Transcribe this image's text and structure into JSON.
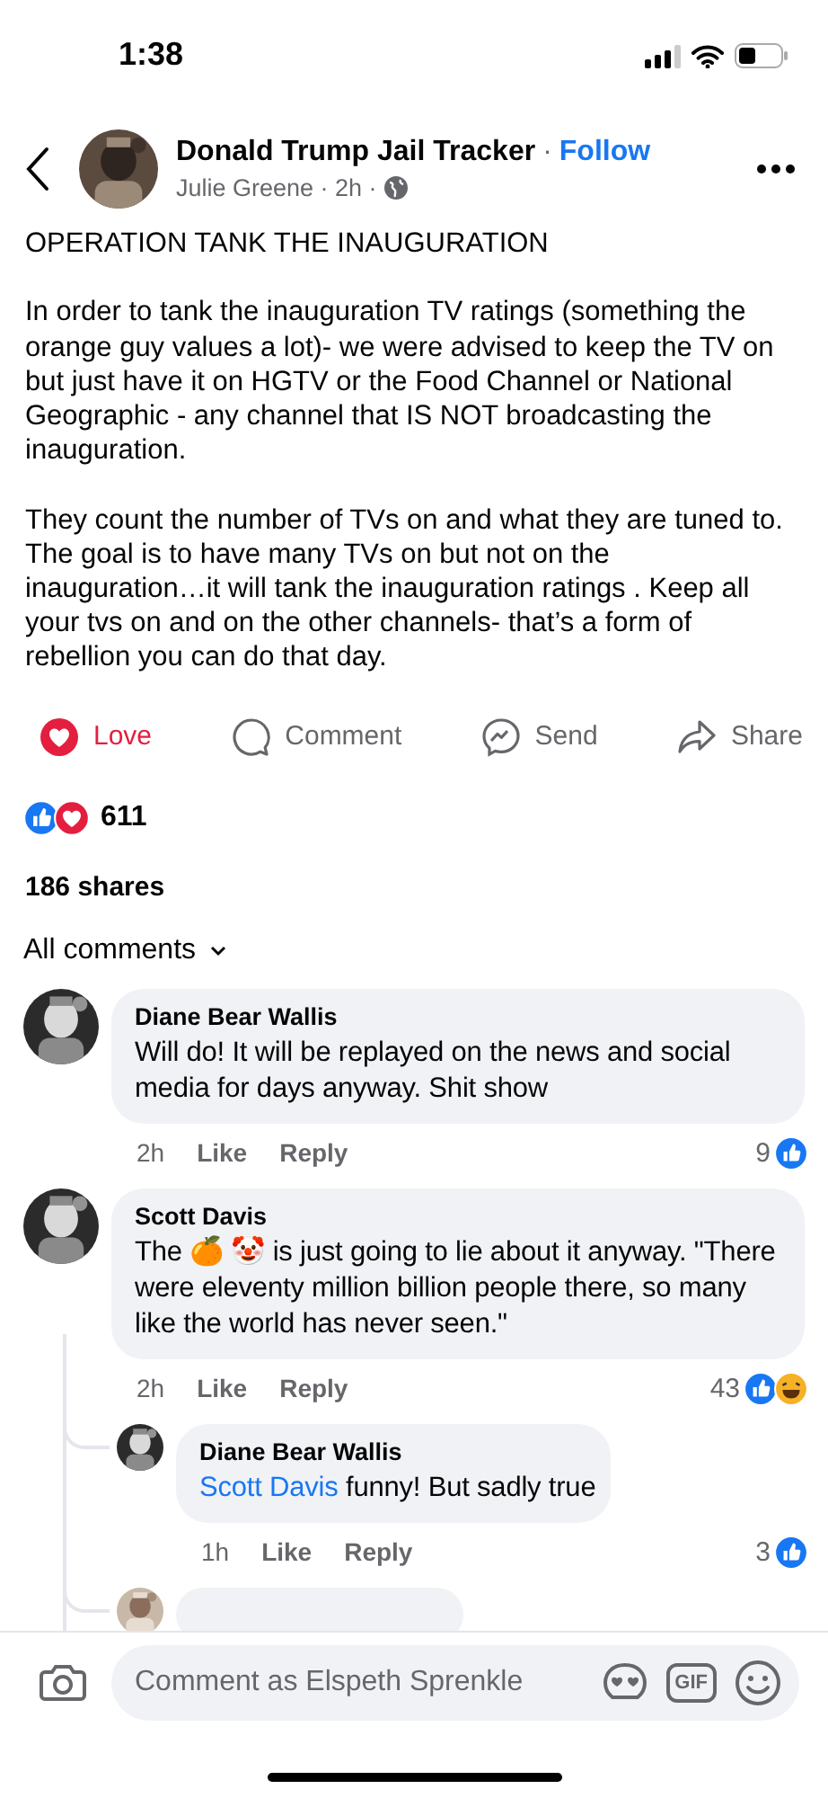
{
  "status_bar": {
    "time": "1:38"
  },
  "header": {
    "page_name": "Donald Trump Jail Tracker",
    "separator": "·",
    "follow": "Follow",
    "byline": "Julie Greene · 2h ·"
  },
  "post": {
    "paragraphs": [
      "OPERATION TANK THE INAUGURATION",
      "In order to tank the inauguration TV  ratings (something the orange guy values a lot)- we were advised to keep the TV on but just have it on HGTV or the Food Channel  or National Geographic - any channel that IS NOT broadcasting the inauguration.",
      "They count the number of TVs on and what they are tuned to. The goal is to have many TVs on but not on the inauguration…it will tank the inauguration ratings . Keep all your tvs on and on the other channels- that’s a form of rebellion you can do that day."
    ]
  },
  "actions": [
    {
      "kind": "love",
      "label": "Love",
      "selected": true
    },
    {
      "kind": "comment",
      "label": "Comment",
      "selected": false
    },
    {
      "kind": "send",
      "label": "Send",
      "selected": false
    },
    {
      "kind": "share",
      "label": "Share",
      "selected": false
    }
  ],
  "reactions": {
    "types": [
      {
        "kind": "like"
      },
      {
        "kind": "love"
      }
    ],
    "count": "611"
  },
  "shares": "186 shares",
  "sort": {
    "label": "All comments"
  },
  "comments": [
    {
      "kind": "comment",
      "author": "Diane Bear Wallis",
      "text": "Will do! It will be replayed on the news and social media for days anyway. Shit show",
      "time": "2h",
      "like": "Like",
      "reply": "Reply",
      "count": "9",
      "reactions": [
        {
          "kind": "like"
        }
      ]
    },
    {
      "kind": "comment",
      "author": "Scott Davis",
      "text": "The 🍊 🤡 is just going to lie about it anyway. \"There were eleventy million billion people there, so many like the world has never seen.\"",
      "time": "2h",
      "like": "Like",
      "reply": "Reply",
      "count": "43",
      "reactions": [
        {
          "kind": "like"
        },
        {
          "kind": "haha"
        }
      ],
      "children": [
        {
          "kind": "comment",
          "author": "Diane Bear Wallis",
          "mention": "Scott Davis",
          "text": "funny! But sadly true",
          "time": "1h",
          "like": "Like",
          "reply": "Reply",
          "count": "3",
          "reactions": [
            {
              "kind": "like"
            }
          ]
        },
        {
          "kind": "partial"
        }
      ]
    }
  ],
  "composer": {
    "placeholder": "Comment as Elspeth Sprenkle",
    "gif": "GIF"
  }
}
